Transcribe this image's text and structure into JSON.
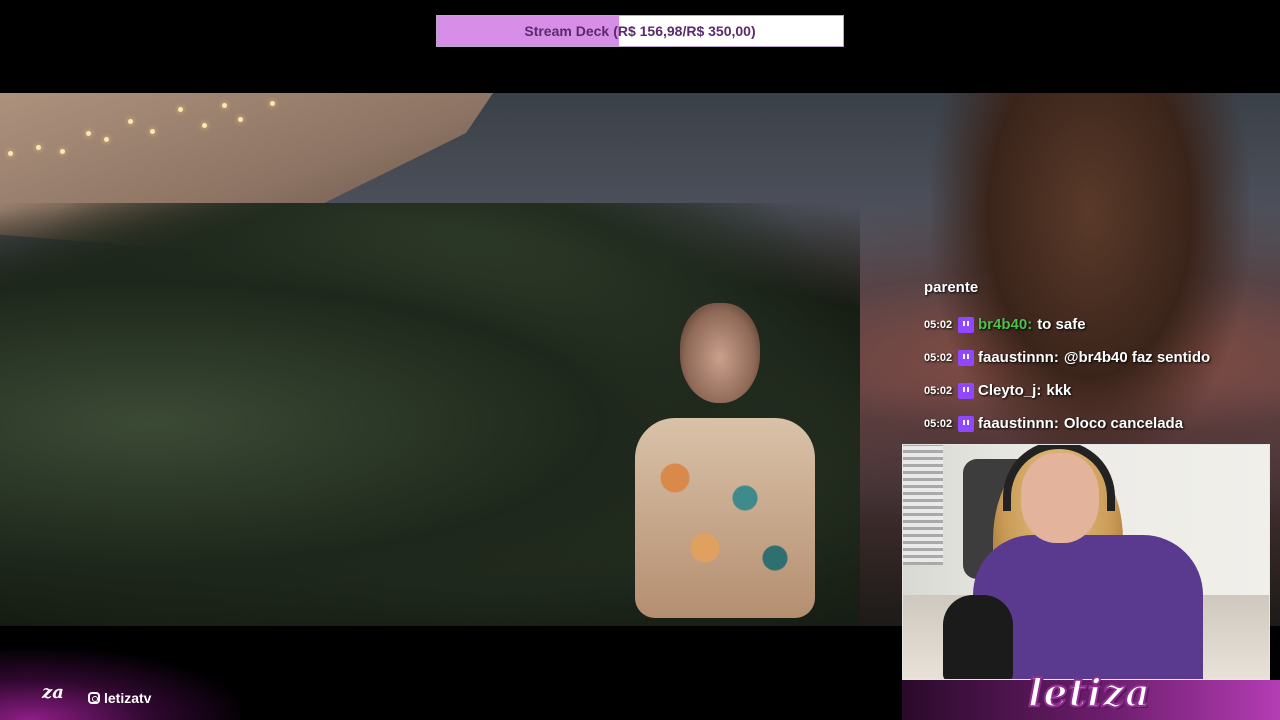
{
  "goal": {
    "label": "Stream Deck",
    "amount_text": "(R$ 156,98/R$ 350,00)",
    "progress_fraction": 0.4485,
    "fill_color": "#d68ee6",
    "bg_color": "#ffffff"
  },
  "chat": {
    "cut_off_line": "",
    "continuation": "parente",
    "messages": [
      {
        "time": "05:02",
        "user": "br4b40:",
        "user_color": "#4cbf4c",
        "text": "to safe"
      },
      {
        "time": "05:02",
        "user": "faaustinnn:",
        "user_color": "#ffffff",
        "text": "@br4b40 faz sentido"
      },
      {
        "time": "05:02",
        "user": "Cleyto_j:",
        "user_color": "#ffffff",
        "text": "kkk"
      },
      {
        "time": "05:02",
        "user": "faaustinnn:",
        "user_color": "#ffffff",
        "text": "Oloco cancelada"
      }
    ]
  },
  "overlay": {
    "short_logo": "za",
    "instagram_handle": "letizatv",
    "brand_name": "letiza"
  },
  "icons": {
    "badge": "twitch-icon",
    "social": "instagram-icon"
  }
}
